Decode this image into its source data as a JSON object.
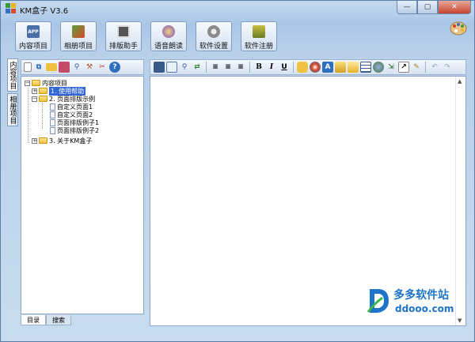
{
  "window": {
    "title": "KM盒子 V3.6",
    "controls": [
      "—",
      "▢",
      "✕"
    ]
  },
  "main_toolbar": [
    {
      "label": "内容项目",
      "icon": "app-icon",
      "icon_text": "APP",
      "color": "#4a6fa8"
    },
    {
      "label": "相册项目",
      "icon": "album-icon",
      "icon_text": "",
      "color": "#3b8a3e"
    },
    {
      "label": "排版助手",
      "icon": "layout-icon",
      "icon_text": "",
      "color": "#555555"
    },
    {
      "label": "语音朗读",
      "icon": "voice-icon",
      "icon_text": "",
      "color": "#7b4bb3"
    },
    {
      "label": "软件设置",
      "icon": "gear-icon",
      "icon_text": "",
      "color": "#8a8a8a"
    },
    {
      "label": "软件注册",
      "icon": "register-icon",
      "icon_text": "",
      "color": "#6a7a25"
    }
  ],
  "side_tabs": [
    "内容项目",
    "相册项目"
  ],
  "left_toolbar_icons": [
    "new-file-icon",
    "copy-icon",
    "open-folder-icon",
    "save-icon",
    "find-icon",
    "tools-icon",
    "cut-icon",
    "help-icon"
  ],
  "tree": {
    "root": "内容项目",
    "items": [
      {
        "label": "1. 使用帮助",
        "level": 1,
        "type": "folder",
        "expander": "+",
        "selected": true
      },
      {
        "label": "2. 页面排版示例",
        "level": 1,
        "type": "folder",
        "expander": "−",
        "selected": false
      },
      {
        "label": "自定义页面1",
        "level": 2,
        "type": "page",
        "expander": "",
        "selected": false
      },
      {
        "label": "自定义页面2",
        "level": 2,
        "type": "page",
        "expander": "",
        "selected": false
      },
      {
        "label": "页面排版例子1",
        "level": 2,
        "type": "page",
        "expander": "",
        "selected": false
      },
      {
        "label": "页面排版例子2",
        "level": 2,
        "type": "page",
        "expander": "",
        "selected": false
      },
      {
        "label": "3. 关于KM盒子",
        "level": 1,
        "type": "folder",
        "expander": "+",
        "selected": false
      }
    ]
  },
  "bottom_tabs": [
    "目录",
    "搜索"
  ],
  "editor_toolbar_icons": [
    "save-icon",
    "preview-icon",
    "find-icon",
    "replace-icon",
    "align-left-icon",
    "align-center-icon",
    "align-right-icon",
    "bold-icon",
    "italic-icon",
    "underline-icon",
    "color-icon",
    "palette-icon",
    "style-icon",
    "picture-icon",
    "image-icon",
    "table-icon",
    "link-icon",
    "import-icon",
    "export-icon",
    "eraser-icon",
    "undo-icon",
    "redo-icon"
  ],
  "editor_toolbar_glyphs": {
    "bold": "B",
    "italic": "I",
    "underline": "U"
  },
  "watermark": {
    "title": "多多软件站",
    "url": "ddooo.com"
  }
}
